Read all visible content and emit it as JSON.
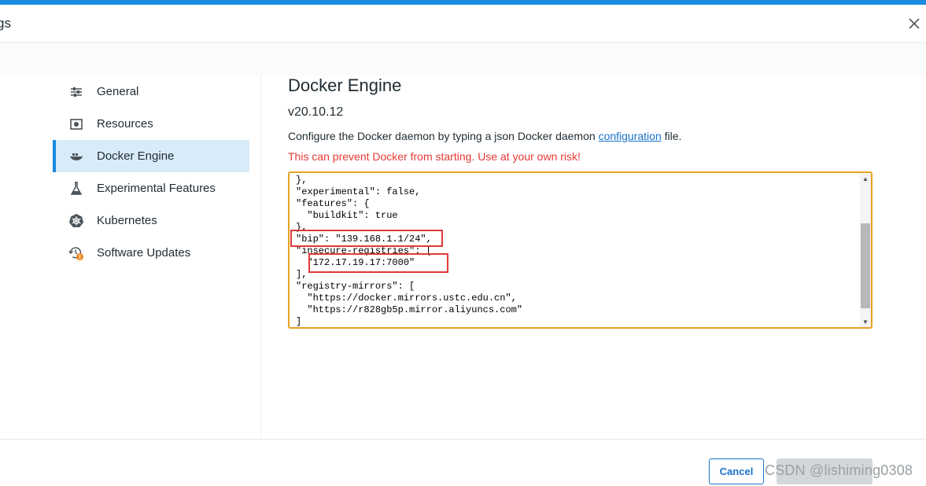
{
  "window": {
    "title": "gs",
    "close_icon": "close-icon"
  },
  "colors": {
    "accent": "#1a8ae0",
    "active_bg": "#d8ebf8",
    "warning": "#e53935",
    "editor_border": "#e6a320",
    "highlight_box": "#e03a3a"
  },
  "sidebar": {
    "items": [
      {
        "label": "General",
        "icon": "sliders-icon",
        "active": false
      },
      {
        "label": "Resources",
        "icon": "resources-icon",
        "active": false
      },
      {
        "label": "Docker Engine",
        "icon": "whale-icon",
        "active": true
      },
      {
        "label": "Experimental Features",
        "icon": "flask-icon",
        "active": false
      },
      {
        "label": "Kubernetes",
        "icon": "helm-wheel-icon",
        "active": false
      },
      {
        "label": "Software Updates",
        "icon": "update-clock-icon",
        "active": false
      }
    ]
  },
  "main": {
    "title": "Docker Engine",
    "version": "v20.10.12",
    "description_before": "Configure the Docker daemon by typing a json Docker daemon ",
    "description_link": "configuration",
    "description_after": " file.",
    "warning": "This can prevent Docker from starting. Use at your own risk!",
    "editor": {
      "code": "},\n\"experimental\": false,\n\"features\": {\n  \"buildkit\": true\n},\n\"bip\": \"139.168.1.1/24\",\n\"insecure-registries\": [\n  \"172.17.19.17:7000\"\n],\n\"registry-mirrors\": [\n  \"https://docker.mirrors.ustc.edu.cn\",\n  \"https://r828gb5p.mirror.aliyuncs.com\"\n]"
    }
  },
  "footer": {
    "cancel_label": "Cancel",
    "watermark": "CSDN @lishiming0308"
  }
}
